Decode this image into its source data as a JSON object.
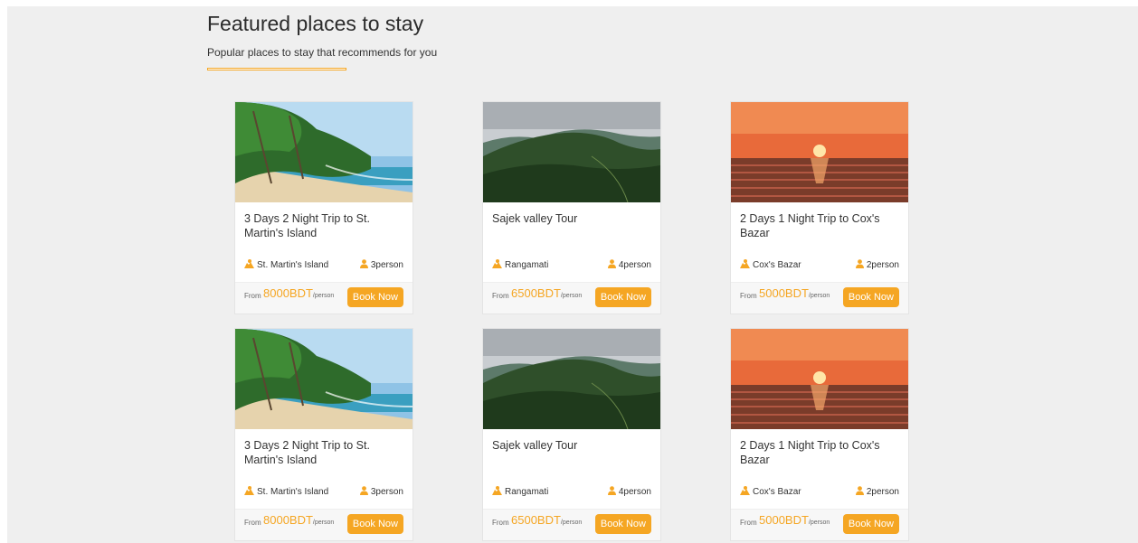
{
  "section": {
    "title": "Featured places to stay",
    "subtitle": "Popular places to stay that recommends for you"
  },
  "cards": [
    {
      "title": "3 Days 2 Night Trip to St. Martin's Island",
      "location": "St. Martin's Island",
      "people": "3person",
      "from": "From",
      "price": "8000BDT",
      "per": "/person",
      "button": "Book Now",
      "image": "beach"
    },
    {
      "title": "Sajek valley Tour",
      "location": "Rangamati",
      "people": "4person",
      "from": "From",
      "price": "6500BDT",
      "per": "/person",
      "button": "Book Now",
      "image": "mountain"
    },
    {
      "title": "2 Days 1 Night Trip to Cox's Bazar",
      "location": "Cox's Bazar",
      "people": "2person",
      "from": "From",
      "price": "5000BDT",
      "per": "/person",
      "button": "Book Now",
      "image": "sunset"
    },
    {
      "title": "3 Days 2 Night Trip to St. Martin's Island",
      "location": "St. Martin's Island",
      "people": "3person",
      "from": "From",
      "price": "8000BDT",
      "per": "/person",
      "button": "Book Now",
      "image": "beach"
    },
    {
      "title": "Sajek valley Tour",
      "location": "Rangamati",
      "people": "4person",
      "from": "From",
      "price": "6500BDT",
      "per": "/person",
      "button": "Book Now",
      "image": "mountain"
    },
    {
      "title": "2 Days 1 Night Trip to Cox's Bazar",
      "location": "Cox's Bazar",
      "people": "2person",
      "from": "From",
      "price": "5000BDT",
      "per": "/person",
      "button": "Book Now",
      "image": "sunset"
    }
  ],
  "colors": {
    "accent": "#f5a623",
    "background": "#efefef"
  },
  "icons": {
    "location": "map-pin-icon",
    "people": "person-icon"
  }
}
